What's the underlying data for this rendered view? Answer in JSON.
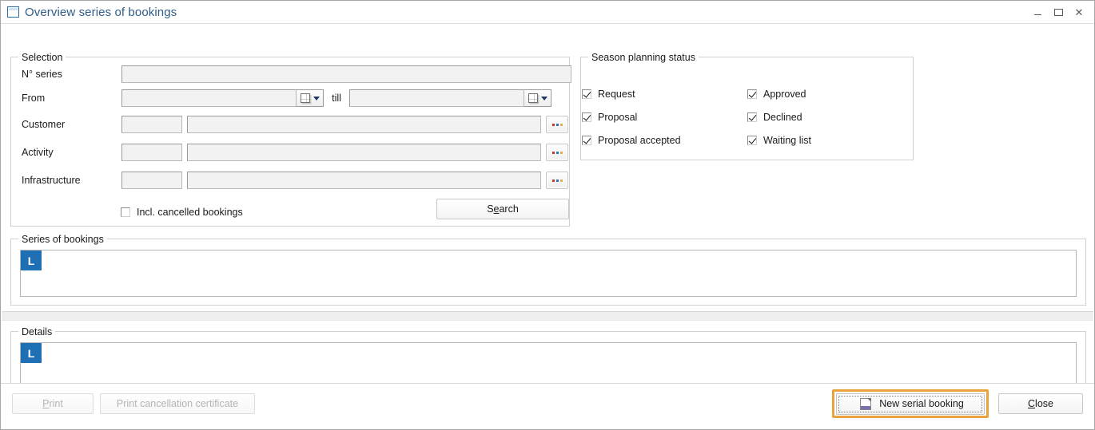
{
  "window": {
    "title": "Overview series of bookings",
    "icon": "window-icon",
    "controls": {
      "minimize": "minimize-icon",
      "maximize": "maximize-icon",
      "close": "close-icon"
    }
  },
  "selection": {
    "legend": "Selection",
    "fields": {
      "n_series": {
        "label": "N° series",
        "value": "",
        "placeholder": ""
      },
      "from": {
        "label": "From",
        "value": "",
        "placeholder": ""
      },
      "till": {
        "label": "till",
        "value": "",
        "placeholder": ""
      },
      "customer": {
        "label": "Customer",
        "code": "",
        "value": "",
        "browse": "..."
      },
      "activity": {
        "label": "Activity",
        "code": "",
        "value": "",
        "browse": "..."
      },
      "infrastructure": {
        "label": "Infrastructure",
        "code": "",
        "value": "",
        "browse": "..."
      }
    },
    "incl_cancelled": {
      "label": "Incl. cancelled bookings",
      "checked": false
    },
    "search_button": {
      "label": "Search",
      "accel": "e"
    }
  },
  "season_planning_status": {
    "legend": "Season planning status",
    "left_column": [
      {
        "label": "Request",
        "checked": true
      },
      {
        "label": "Proposal",
        "checked": true
      },
      {
        "label": "Proposal accepted",
        "checked": true
      }
    ],
    "right_column": [
      {
        "label": "Approved",
        "checked": true
      },
      {
        "label": "Declined",
        "checked": true
      },
      {
        "label": "Waiting list",
        "checked": true
      }
    ]
  },
  "series_of_bookings": {
    "legend": "Series of bookings",
    "grid_marker": "L",
    "rows": []
  },
  "details": {
    "legend": "Details",
    "grid_marker": "L",
    "rows": []
  },
  "footer": {
    "print": {
      "label": "Print",
      "accel": "P",
      "disabled": true
    },
    "print_cancellation_certificate": {
      "label": "Print cancellation certificate",
      "disabled": true
    },
    "new_serial_booking": {
      "label": "New serial booking",
      "icon": "page-icon",
      "highlighted": true
    },
    "close": {
      "label": "Close",
      "accel": "C"
    }
  },
  "colors": {
    "title_text": "#2f5c88",
    "grid_marker_bg": "#1f6fb5",
    "highlight_border": "#e8a33d",
    "field_bg": "#f2f2f2",
    "panel_border": "#d0d0d0"
  }
}
